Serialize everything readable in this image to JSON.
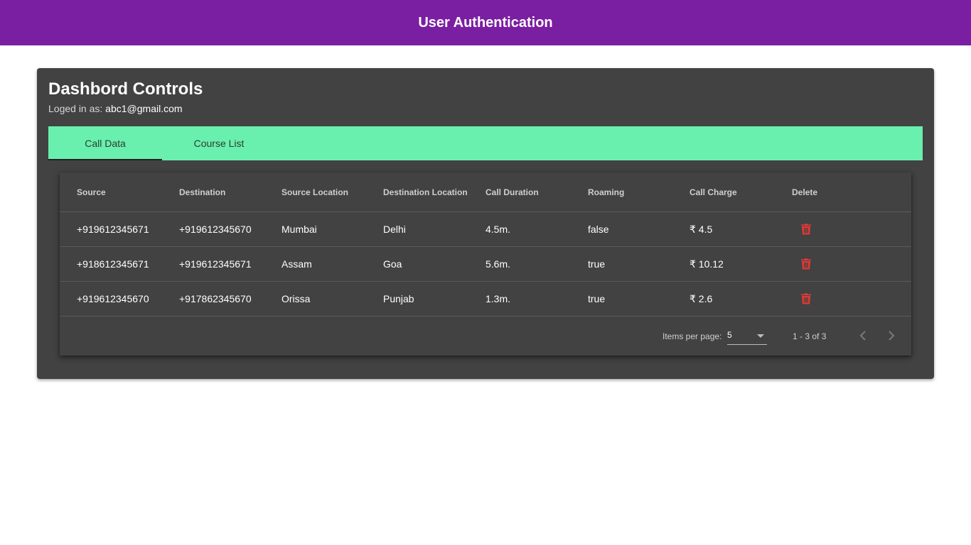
{
  "toolbar": {
    "title": "User Authentication",
    "color": "#7b1fa2"
  },
  "card": {
    "title": "Dashbord Controls",
    "subtitle_prefix": "Loged in as: ",
    "user_email": "abc1@gmail.com"
  },
  "tabs": {
    "accent": "#69f0ae",
    "items": [
      {
        "label": "Call Data",
        "active": true
      },
      {
        "label": "Course List",
        "active": false
      }
    ]
  },
  "table": {
    "columns": [
      "Source",
      "Destination",
      "Source Location",
      "Destination Location",
      "Call Duration",
      "Roaming",
      "Call Charge",
      "Delete"
    ],
    "rows": [
      {
        "source": "+919612345671",
        "destination": "+919612345670",
        "source_location": "Mumbai",
        "destination_location": "Delhi",
        "call_duration": "4.5m.",
        "roaming": "false",
        "call_charge": "₹ 4.5",
        "delete_icon": "trash-icon"
      },
      {
        "source": "+918612345671",
        "destination": "+919612345671",
        "source_location": "Assam",
        "destination_location": "Goa",
        "call_duration": "5.6m.",
        "roaming": "true",
        "call_charge": "₹ 10.12",
        "delete_icon": "trash-icon"
      },
      {
        "source": "+919612345670",
        "destination": "+917862345670",
        "source_location": "Orissa",
        "destination_location": "Punjab",
        "call_duration": "1.3m.",
        "roaming": "true",
        "call_charge": "₹ 2.6",
        "delete_icon": "trash-icon"
      }
    ],
    "delete_color": "#e53935"
  },
  "paginator": {
    "items_per_page_label": "Items per page:",
    "page_size": "5",
    "range_label": "1 - 3 of 3",
    "prev_icon": "chevron-left-icon",
    "next_icon": "chevron-right-icon"
  }
}
